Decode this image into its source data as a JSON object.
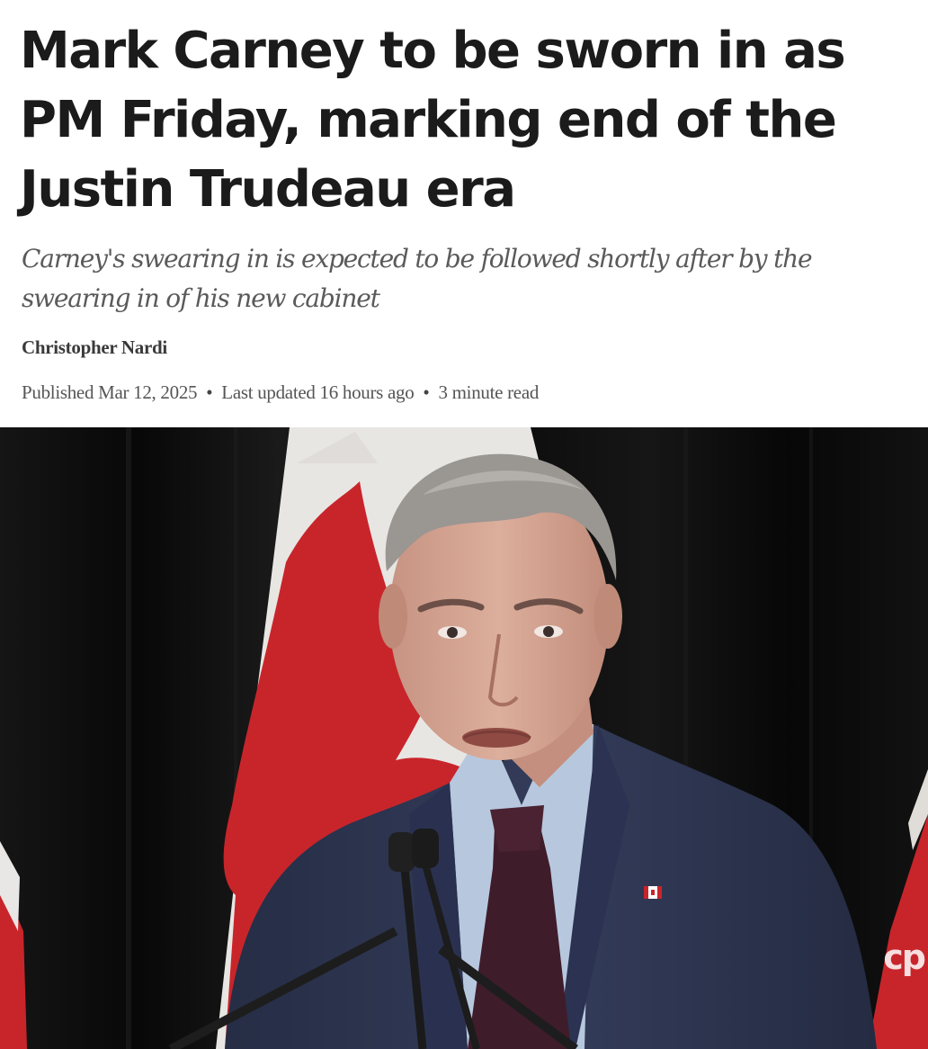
{
  "article": {
    "headline": "Mark Carney to be sworn in as PM Friday, marking end of the Justin Trudeau era",
    "subtitle": "Carney's swearing in is expected to be followed shortly after by the swearing in of his new cabinet",
    "author": "Christopher Nardi",
    "published": "Published Mar 12, 2025",
    "updated": "Last updated 16 hours ago",
    "read_time": "3 minute read"
  },
  "hero_image": {
    "watermark": "cp",
    "colors": {
      "flag_red": "#c8252b",
      "flag_white": "#ecebea",
      "curtain": "#0e0e0e",
      "suit": "#2d3550",
      "shirt": "#b7c8de",
      "tie": "#3f1c2a",
      "skin": "#d6a694",
      "hair": "#9a9692"
    }
  }
}
